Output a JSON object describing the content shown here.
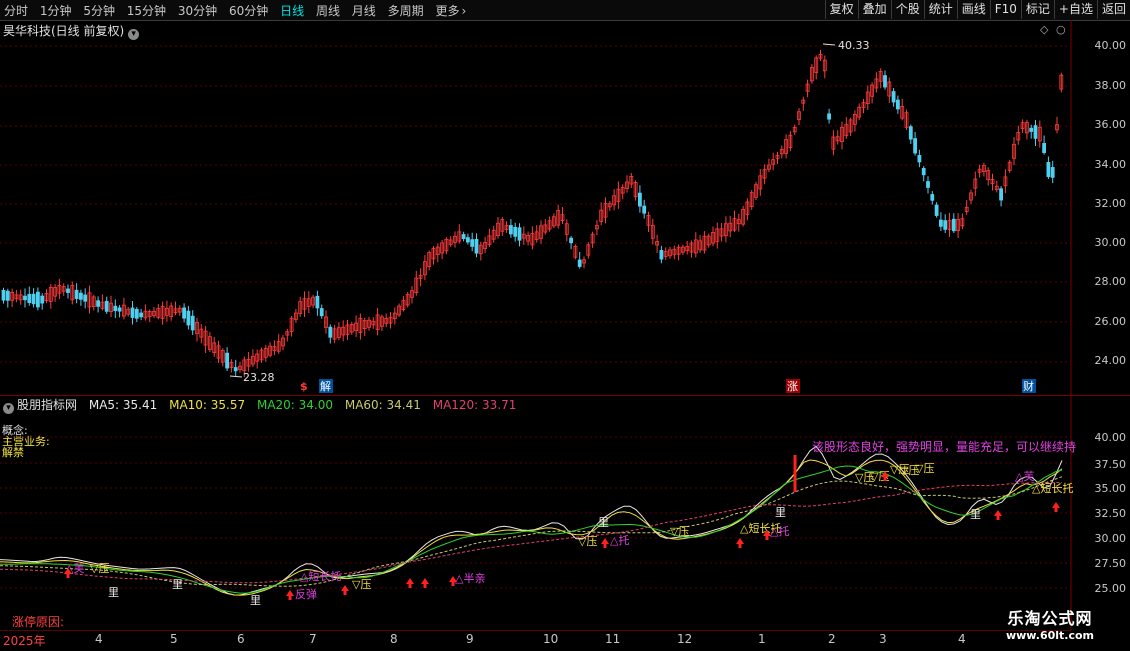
{
  "toolbar": {
    "periods": [
      "分时",
      "1分钟",
      "5分钟",
      "15分钟",
      "30分钟",
      "60分钟",
      "日线",
      "周线",
      "月线",
      "多周期",
      "更多"
    ],
    "more_arrow": "›",
    "active_period": "日线",
    "buttons": [
      "复权",
      "叠加",
      "个股",
      "统计",
      "画线",
      "F10",
      "标记",
      "+自选",
      "返回"
    ]
  },
  "main_chart": {
    "title": "昊华科技(日线 前复权)",
    "high_label": "40.33",
    "low_label": "23.28",
    "y_ticks": [
      "40.00",
      "38.00",
      "36.00",
      "34.00",
      "32.00",
      "30.00",
      "28.00",
      "26.00",
      "24.00"
    ],
    "markers": [
      "$",
      "解",
      "涨",
      "财"
    ]
  },
  "indicator": {
    "name": "股朋指标网",
    "ma": [
      {
        "label": "MA5: 35.41",
        "color": "#e8e8e8"
      },
      {
        "label": "MA10: 35.57",
        "color": "#f0e040"
      },
      {
        "label": "MA20: 34.00",
        "color": "#30d030"
      },
      {
        "label": "MA60: 34.41",
        "color": "#c8c870"
      },
      {
        "label": "MA120: 33.71",
        "color": "#e04070"
      }
    ],
    "left_labels": [
      "概念:",
      "主营业务:",
      "解禁"
    ],
    "comment": "该股形态良好，强势明显，量能充足，可以继续持",
    "y_ticks": [
      "40.00",
      "37.50",
      "35.00",
      "32.50",
      "30.00",
      "27.50",
      "25.00"
    ],
    "annotations": [
      "△芙",
      "▽压",
      "里",
      "△短长托",
      "▽压",
      "反弹",
      "△半亲",
      "里",
      "▽压",
      "▽压",
      "△托",
      "▽压",
      "▽压",
      "△短长托",
      "△托",
      "里",
      "▽压",
      "▽压",
      "▽压",
      "里",
      "△芙",
      "△短长托",
      "里",
      "里"
    ],
    "limit_reason": "涨停原因:"
  },
  "timeline": [
    "2025年",
    "4",
    "5",
    "6",
    "7",
    "8",
    "9",
    "10",
    "11",
    "12",
    "1",
    "2",
    "3",
    "4"
  ],
  "watermark": {
    "title": "乐淘公式网",
    "url": "www.60lt.com"
  },
  "colors": {
    "up": "#ff3b3b",
    "down": "#50d0f0",
    "grid": "#5a0000",
    "active": "#00e5e5"
  }
}
